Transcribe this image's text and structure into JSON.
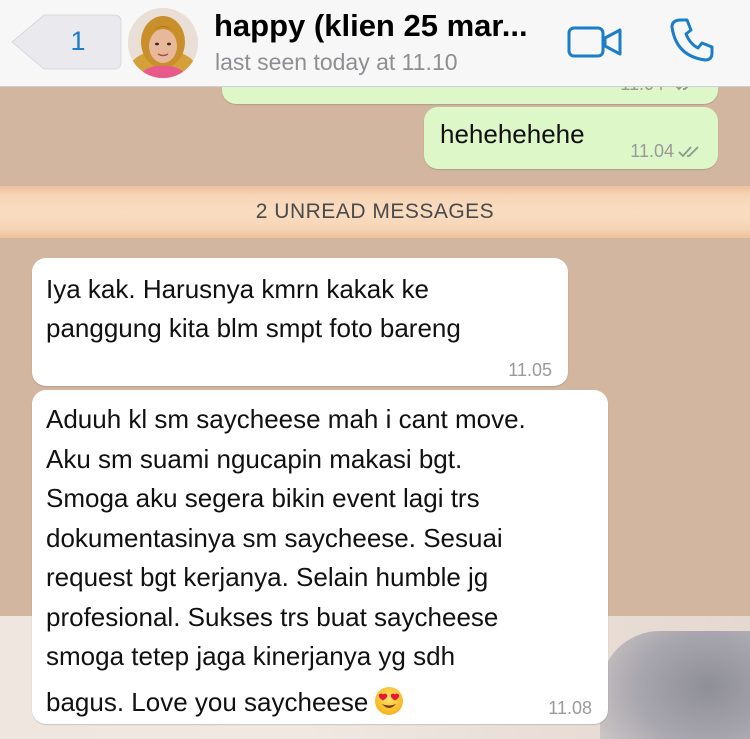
{
  "header": {
    "back_count": "1",
    "contact_name": "happy (klien 25 mar...",
    "last_seen": "last seen today at 11.10"
  },
  "messages": {
    "previous_partial_time": "11.04",
    "hehe": {
      "text": "hehehehehe",
      "time": "11.04"
    },
    "unread_banner": "2 UNREAD MESSAGES",
    "iya": {
      "lines": [
        "Iya kak. Harusnya kmrn kakak ke",
        "panggung kita blm smpt foto bareng"
      ],
      "time": "11.05"
    },
    "aduuh": {
      "lines": [
        "Aduuh kl sm saycheese mah i cant move.",
        "Aku sm suami ngucapin makasi bgt.",
        "Smoga aku segera bikin event lagi trs",
        "dokumentasinya sm saycheese. Sesuai",
        "request bgt kerjanya. Selain humble jg",
        "profesional. Sukses trs buat saycheese",
        "smoga tetep jaga kinerjanya yg sdh",
        "bagus. Love you saycheese"
      ],
      "emoji": "heart-eyes-emoji",
      "time": "11.08"
    }
  },
  "icons": {
    "back": "chevron-left-icon",
    "video": "video-camera-icon",
    "call": "phone-icon",
    "read_receipt": "double-check-icon"
  },
  "colors": {
    "accent": "#1a7ec9",
    "outgoing_bubble": "#ddf7c8",
    "incoming_bubble": "#ffffff",
    "chat_background": "#d3b6a0",
    "unread_banner": "#f9dcbf"
  }
}
